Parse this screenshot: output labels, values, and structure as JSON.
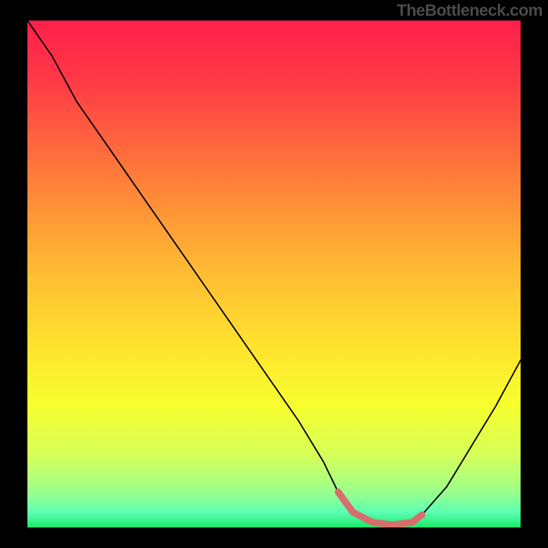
{
  "watermark": "TheBottleneck.com",
  "chart_data": {
    "type": "line",
    "title": "",
    "xlabel": "",
    "ylabel": "",
    "xlim": [
      0,
      100
    ],
    "ylim": [
      0,
      100
    ],
    "series": [
      {
        "name": "curve",
        "x": [
          0,
          5,
          10,
          15,
          20,
          25,
          30,
          35,
          40,
          45,
          50,
          55,
          60,
          63,
          66,
          70,
          74,
          78,
          80,
          85,
          90,
          95,
          100
        ],
        "values": [
          100,
          93,
          84,
          77,
          70,
          63,
          56,
          49,
          42,
          35,
          28,
          21,
          13,
          7,
          3,
          1,
          0.5,
          1,
          2.5,
          8,
          16,
          24,
          33
        ]
      },
      {
        "name": "pink-highlight",
        "x": [
          63,
          66,
          70,
          74,
          78,
          80
        ],
        "values": [
          7,
          3,
          1,
          0.5,
          1,
          2.5
        ]
      }
    ],
    "background_gradient": {
      "stops": [
        {
          "offset": 0.0,
          "color": "#ff1f4b"
        },
        {
          "offset": 0.12,
          "color": "#ff3a46"
        },
        {
          "offset": 0.3,
          "color": "#ff7a3a"
        },
        {
          "offset": 0.48,
          "color": "#ffb733"
        },
        {
          "offset": 0.64,
          "color": "#ffe22e"
        },
        {
          "offset": 0.76,
          "color": "#f7ff2e"
        },
        {
          "offset": 0.86,
          "color": "#d4ff5a"
        },
        {
          "offset": 0.93,
          "color": "#9bff8c"
        },
        {
          "offset": 0.97,
          "color": "#5cffb3"
        },
        {
          "offset": 1.0,
          "color": "#19e86a"
        }
      ]
    },
    "curve_color": "#000000",
    "highlight_color": "#d96d6d"
  }
}
